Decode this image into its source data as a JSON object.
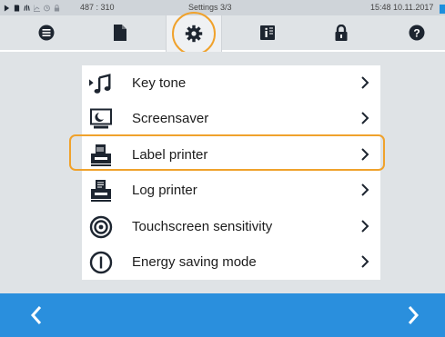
{
  "status_bar": {
    "icons": [
      "play-icon",
      "sd-card-icon",
      "wifi-icon",
      "chart-icon",
      "clock-icon",
      "lock-icon"
    ],
    "coordinates": "487 : 310",
    "title": "Settings 3/3",
    "datetime": "15:48 10.11.2017"
  },
  "tabs": [
    {
      "name": "list-icon",
      "active": false
    },
    {
      "name": "document-icon",
      "active": false
    },
    {
      "name": "gear-icon",
      "active": true
    },
    {
      "name": "info-book-icon",
      "active": false
    },
    {
      "name": "lock-icon",
      "active": false
    },
    {
      "name": "help-icon",
      "active": false
    }
  ],
  "menu": {
    "items": [
      {
        "label": "Key tone",
        "icon": "music-note-icon"
      },
      {
        "label": "Screensaver",
        "icon": "screensaver-icon"
      },
      {
        "label": "Label printer",
        "icon": "label-printer-icon"
      },
      {
        "label": "Log printer",
        "icon": "log-printer-icon"
      },
      {
        "label": "Touchscreen sensitivity",
        "icon": "target-icon"
      },
      {
        "label": "Energy saving mode",
        "icon": "power-icon"
      }
    ],
    "highlighted_item": "Label printer"
  },
  "navigation": {
    "back": "chevron-left-icon",
    "next": "chevron-right-icon"
  },
  "colors": {
    "accent_blue": "#2a8fdd",
    "highlight_orange": "#f0a22c",
    "background_grey": "#dfe3e6",
    "icon_dark": "#1d2530"
  }
}
